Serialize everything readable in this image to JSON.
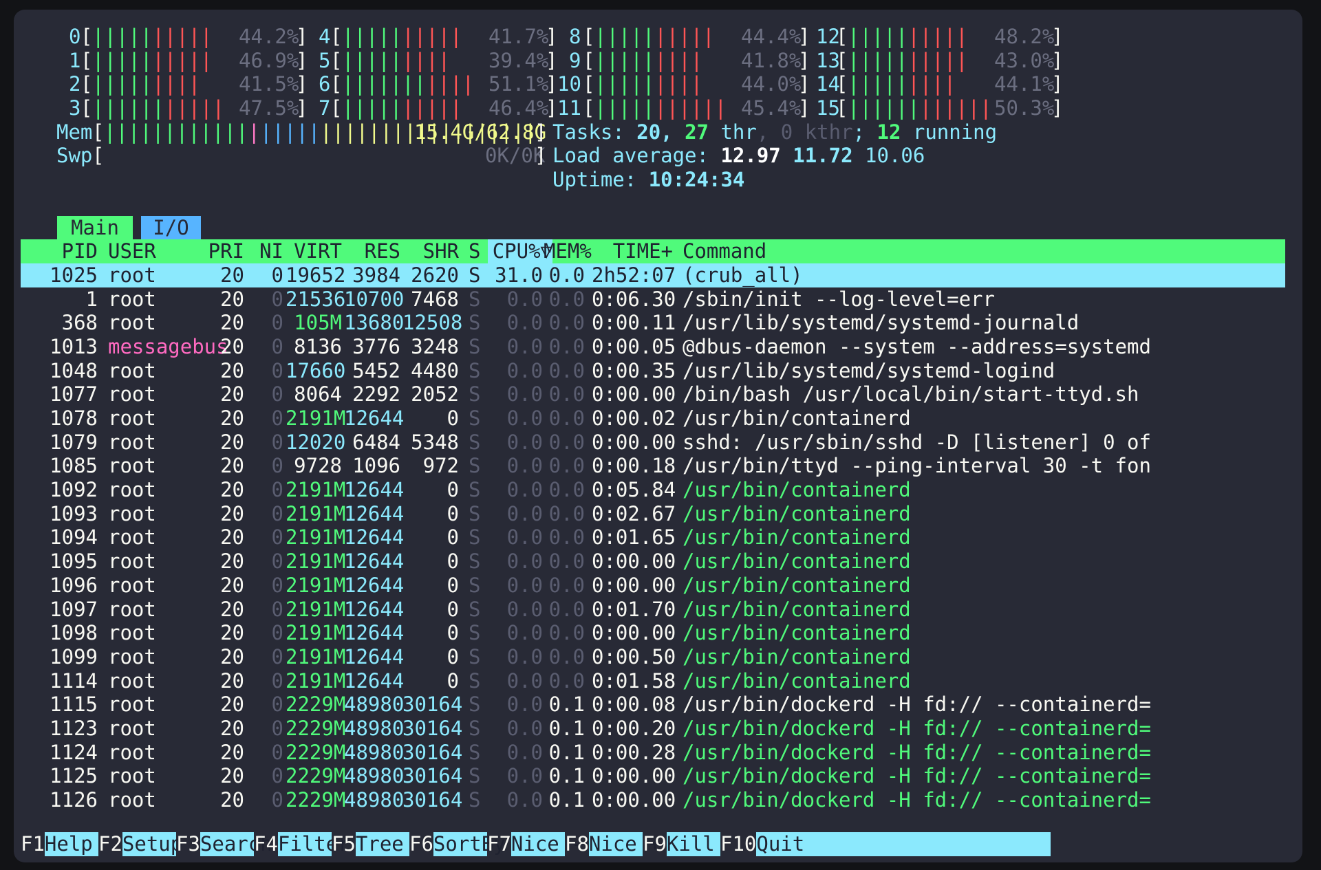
{
  "cpus": [
    {
      "id": "0",
      "green": 5,
      "red": 5,
      "pct": "44.2%"
    },
    {
      "id": "1",
      "green": 5,
      "red": 5,
      "pct": "46.9%"
    },
    {
      "id": "2",
      "green": 5,
      "red": 4,
      "pct": "41.5%"
    },
    {
      "id": "3",
      "green": 6,
      "red": 5,
      "pct": "47.5%"
    },
    {
      "id": "4",
      "green": 5,
      "red": 5,
      "pct": "41.7%"
    },
    {
      "id": "5",
      "green": 5,
      "red": 4,
      "pct": "39.4%"
    },
    {
      "id": "6",
      "green": 7,
      "red": 4,
      "pct": "51.1%"
    },
    {
      "id": "7",
      "green": 5,
      "red": 5,
      "pct": "46.4%"
    },
    {
      "id": "8",
      "green": 5,
      "red": 5,
      "pct": "44.4%"
    },
    {
      "id": "9",
      "green": 5,
      "red": 4,
      "pct": "41.8%"
    },
    {
      "id": "10",
      "green": 5,
      "red": 4,
      "pct": "44.0%"
    },
    {
      "id": "11",
      "green": 5,
      "red": 6,
      "pct": "45.4%"
    },
    {
      "id": "12",
      "green": 5,
      "red": 5,
      "pct": "48.2%"
    },
    {
      "id": "13",
      "green": 5,
      "red": 5,
      "pct": "43.0%"
    },
    {
      "id": "14",
      "green": 5,
      "red": 4,
      "pct": "44.1%"
    },
    {
      "id": "15",
      "green": 6,
      "red": 6,
      "pct": "50.3%"
    }
  ],
  "mem": {
    "label": "Mem",
    "value": "15.4G/62.8G",
    "bars": {
      "green": 12,
      "magenta": 1,
      "blue": 5,
      "yellow": 18
    }
  },
  "swp": {
    "label": "Swp",
    "value": "0K/0K"
  },
  "tasks": {
    "label": "Tasks:",
    "tasks": "20",
    "thr": "27",
    "thr_label": "thr",
    "kthr": "0",
    "kthr_label": "kthr",
    "running": "12",
    "running_label": "running"
  },
  "load": {
    "label": "Load average:",
    "l1": "12.97",
    "l5": "11.72",
    "l15": "10.06"
  },
  "uptime": {
    "label": "Uptime:",
    "value": "10:24:34"
  },
  "tabs": [
    {
      "label": "Main"
    },
    {
      "label": "I/O"
    }
  ],
  "columns": {
    "pid": "PID",
    "user": "USER",
    "pri": "PRI",
    "ni": "NI",
    "virt": "VIRT",
    "res": "RES",
    "shr": "SHR",
    "s": "S",
    "cpu": "CPU%▽",
    "mem": "MEM%",
    "time": "TIME+",
    "cmd": "Command"
  },
  "processes": [
    {
      "pid": "1025",
      "user": "root",
      "pri": "20",
      "ni": "0",
      "virt": "19652",
      "res": "3984",
      "shr": "2620",
      "s": "S",
      "cpu": "31.0",
      "mem": "0.0",
      "time": "2h52:07",
      "cmd": "(crub_all)",
      "thread": false
    },
    {
      "pid": "1",
      "user": "root",
      "pri": "20",
      "ni": "0",
      "virt": "21536",
      "res": "10700",
      "shr": "7468",
      "s": "S",
      "cpu": "0.0",
      "mem": "0.0",
      "time": "0:06.30",
      "cmd": "/sbin/init --log-level=err",
      "thread": false
    },
    {
      "pid": "368",
      "user": "root",
      "pri": "20",
      "ni": "0",
      "virt": "105M",
      "res": "13680",
      "shr": "12508",
      "s": "S",
      "cpu": "0.0",
      "mem": "0.0",
      "time": "0:00.11",
      "cmd": "/usr/lib/systemd/systemd-journald",
      "thread": false
    },
    {
      "pid": "1013",
      "user": "messagebus",
      "pri": "20",
      "ni": "0",
      "virt": "8136",
      "res": "3776",
      "shr": "3248",
      "s": "S",
      "cpu": "0.0",
      "mem": "0.0",
      "time": "0:00.05",
      "cmd": "@dbus-daemon --system --address=systemd",
      "thread": false
    },
    {
      "pid": "1048",
      "user": "root",
      "pri": "20",
      "ni": "0",
      "virt": "17660",
      "res": "5452",
      "shr": "4480",
      "s": "S",
      "cpu": "0.0",
      "mem": "0.0",
      "time": "0:00.35",
      "cmd": "/usr/lib/systemd/systemd-logind",
      "thread": false
    },
    {
      "pid": "1077",
      "user": "root",
      "pri": "20",
      "ni": "0",
      "virt": "8064",
      "res": "2292",
      "shr": "2052",
      "s": "S",
      "cpu": "0.0",
      "mem": "0.0",
      "time": "0:00.00",
      "cmd": "/bin/bash /usr/local/bin/start-ttyd.sh",
      "thread": false
    },
    {
      "pid": "1078",
      "user": "root",
      "pri": "20",
      "ni": "0",
      "virt": "2191M",
      "res": "12644",
      "shr": "0",
      "s": "S",
      "cpu": "0.0",
      "mem": "0.0",
      "time": "0:00.02",
      "cmd": "/usr/bin/containerd",
      "thread": false
    },
    {
      "pid": "1079",
      "user": "root",
      "pri": "20",
      "ni": "0",
      "virt": "12020",
      "res": "6484",
      "shr": "5348",
      "s": "S",
      "cpu": "0.0",
      "mem": "0.0",
      "time": "0:00.00",
      "cmd": "sshd: /usr/sbin/sshd -D [listener] 0 of",
      "thread": false
    },
    {
      "pid": "1085",
      "user": "root",
      "pri": "20",
      "ni": "0",
      "virt": "9728",
      "res": "1096",
      "shr": "972",
      "s": "S",
      "cpu": "0.0",
      "mem": "0.0",
      "time": "0:00.18",
      "cmd": "/usr/bin/ttyd --ping-interval 30 -t fon",
      "thread": false
    },
    {
      "pid": "1092",
      "user": "root",
      "pri": "20",
      "ni": "0",
      "virt": "2191M",
      "res": "12644",
      "shr": "0",
      "s": "S",
      "cpu": "0.0",
      "mem": "0.0",
      "time": "0:05.84",
      "cmd": "/usr/bin/containerd",
      "thread": true
    },
    {
      "pid": "1093",
      "user": "root",
      "pri": "20",
      "ni": "0",
      "virt": "2191M",
      "res": "12644",
      "shr": "0",
      "s": "S",
      "cpu": "0.0",
      "mem": "0.0",
      "time": "0:02.67",
      "cmd": "/usr/bin/containerd",
      "thread": true
    },
    {
      "pid": "1094",
      "user": "root",
      "pri": "20",
      "ni": "0",
      "virt": "2191M",
      "res": "12644",
      "shr": "0",
      "s": "S",
      "cpu": "0.0",
      "mem": "0.0",
      "time": "0:01.65",
      "cmd": "/usr/bin/containerd",
      "thread": true
    },
    {
      "pid": "1095",
      "user": "root",
      "pri": "20",
      "ni": "0",
      "virt": "2191M",
      "res": "12644",
      "shr": "0",
      "s": "S",
      "cpu": "0.0",
      "mem": "0.0",
      "time": "0:00.00",
      "cmd": "/usr/bin/containerd",
      "thread": true
    },
    {
      "pid": "1096",
      "user": "root",
      "pri": "20",
      "ni": "0",
      "virt": "2191M",
      "res": "12644",
      "shr": "0",
      "s": "S",
      "cpu": "0.0",
      "mem": "0.0",
      "time": "0:00.00",
      "cmd": "/usr/bin/containerd",
      "thread": true
    },
    {
      "pid": "1097",
      "user": "root",
      "pri": "20",
      "ni": "0",
      "virt": "2191M",
      "res": "12644",
      "shr": "0",
      "s": "S",
      "cpu": "0.0",
      "mem": "0.0",
      "time": "0:01.70",
      "cmd": "/usr/bin/containerd",
      "thread": true
    },
    {
      "pid": "1098",
      "user": "root",
      "pri": "20",
      "ni": "0",
      "virt": "2191M",
      "res": "12644",
      "shr": "0",
      "s": "S",
      "cpu": "0.0",
      "mem": "0.0",
      "time": "0:00.00",
      "cmd": "/usr/bin/containerd",
      "thread": true
    },
    {
      "pid": "1099",
      "user": "root",
      "pri": "20",
      "ni": "0",
      "virt": "2191M",
      "res": "12644",
      "shr": "0",
      "s": "S",
      "cpu": "0.0",
      "mem": "0.0",
      "time": "0:00.50",
      "cmd": "/usr/bin/containerd",
      "thread": true
    },
    {
      "pid": "1114",
      "user": "root",
      "pri": "20",
      "ni": "0",
      "virt": "2191M",
      "res": "12644",
      "shr": "0",
      "s": "S",
      "cpu": "0.0",
      "mem": "0.0",
      "time": "0:01.58",
      "cmd": "/usr/bin/containerd",
      "thread": true
    },
    {
      "pid": "1115",
      "user": "root",
      "pri": "20",
      "ni": "0",
      "virt": "2229M",
      "res": "48980",
      "shr": "30164",
      "s": "S",
      "cpu": "0.0",
      "mem": "0.1",
      "time": "0:00.08",
      "cmd": "/usr/bin/dockerd -H fd:// --containerd=",
      "thread": false
    },
    {
      "pid": "1123",
      "user": "root",
      "pri": "20",
      "ni": "0",
      "virt": "2229M",
      "res": "48980",
      "shr": "30164",
      "s": "S",
      "cpu": "0.0",
      "mem": "0.1",
      "time": "0:00.20",
      "cmd": "/usr/bin/dockerd -H fd:// --containerd=",
      "thread": true
    },
    {
      "pid": "1124",
      "user": "root",
      "pri": "20",
      "ni": "0",
      "virt": "2229M",
      "res": "48980",
      "shr": "30164",
      "s": "S",
      "cpu": "0.0",
      "mem": "0.1",
      "time": "0:00.28",
      "cmd": "/usr/bin/dockerd -H fd:// --containerd=",
      "thread": true
    },
    {
      "pid": "1125",
      "user": "root",
      "pri": "20",
      "ni": "0",
      "virt": "2229M",
      "res": "48980",
      "shr": "30164",
      "s": "S",
      "cpu": "0.0",
      "mem": "0.1",
      "time": "0:00.00",
      "cmd": "/usr/bin/dockerd -H fd:// --containerd=",
      "thread": true
    },
    {
      "pid": "1126",
      "user": "root",
      "pri": "20",
      "ni": "0",
      "virt": "2229M",
      "res": "48980",
      "shr": "30164",
      "s": "S",
      "cpu": "0.0",
      "mem": "0.1",
      "time": "0:00.00",
      "cmd": "/usr/bin/dockerd -H fd:// --containerd=",
      "thread": true
    }
  ],
  "fkeys": [
    {
      "key": "F1",
      "label": "Help"
    },
    {
      "key": "F2",
      "label": "Setup"
    },
    {
      "key": "F3",
      "label": "Search"
    },
    {
      "key": "F4",
      "label": "Filter"
    },
    {
      "key": "F5",
      "label": "Tree"
    },
    {
      "key": "F6",
      "label": "SortBy"
    },
    {
      "key": "F7",
      "label": "Nice -"
    },
    {
      "key": "F8",
      "label": "Nice +"
    },
    {
      "key": "F9",
      "label": "Kill"
    },
    {
      "key": "F10",
      "label": "Quit"
    }
  ],
  "colors": {
    "bg": "#282a36",
    "green": "#50fa7b",
    "cyan": "#8be9fd",
    "red": "#ff5555",
    "magenta": "#ff79c6",
    "yellow": "#f1fa8c",
    "blue": "#57b4ff"
  }
}
